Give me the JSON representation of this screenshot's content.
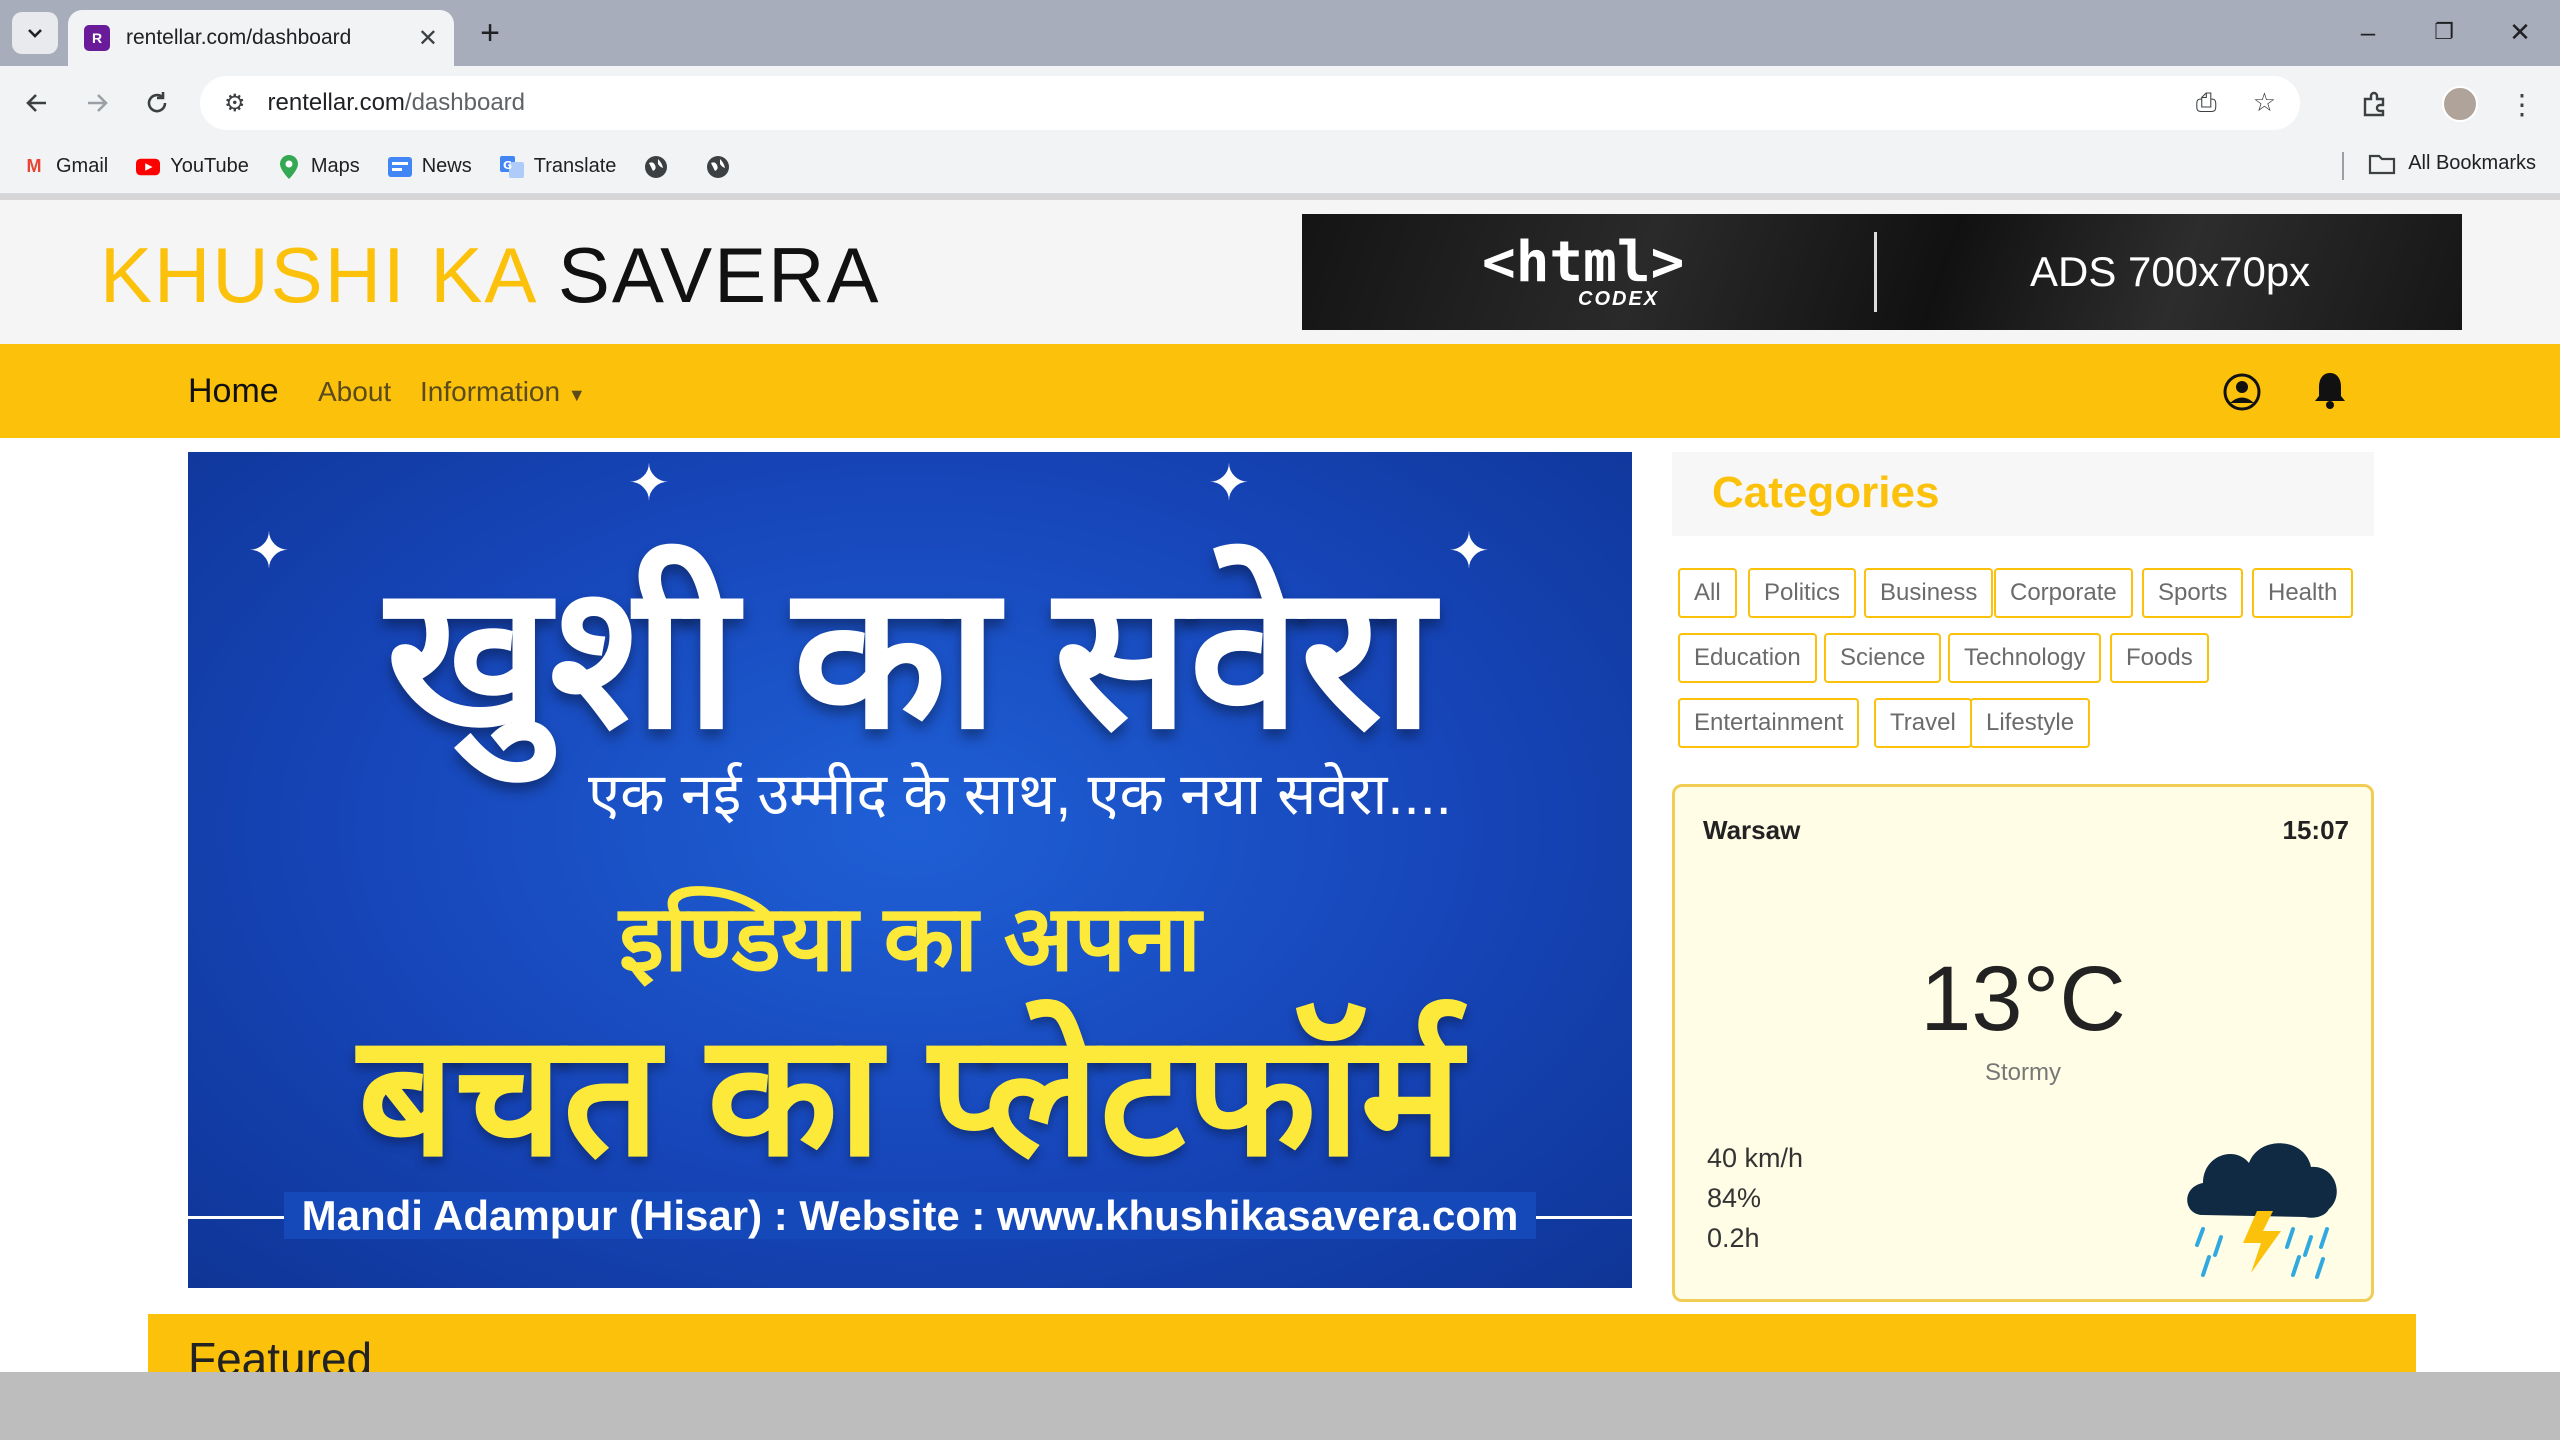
{
  "browser": {
    "tab_title": "rentellar.com/dashboard",
    "url_host": "rentellar.com",
    "url_path": "/dashboard",
    "bookmarks": [
      {
        "label": "Gmail",
        "icon": "gmail-icon"
      },
      {
        "label": "YouTube",
        "icon": "youtube-icon"
      },
      {
        "label": "Maps",
        "icon": "maps-icon"
      },
      {
        "label": "News",
        "icon": "news-icon"
      },
      {
        "label": "Translate",
        "icon": "translate-icon"
      }
    ],
    "all_bookmarks_label": "All Bookmarks"
  },
  "site": {
    "logo_part1": "KHUSHI KA",
    "logo_part2": "SAVERA",
    "ad_html": "<html>",
    "ad_codex": "CODEX",
    "ad_text": "ADS 700x70px"
  },
  "nav": {
    "home": "Home",
    "about": "About",
    "information": "Information"
  },
  "hero": {
    "title": "खुशी का सवेरा",
    "subtitle": "एक नई उम्मीद के साथ, एक नया सवेरा....",
    "line3": "इण्डिया का अपना",
    "line4": "बचत का प्लेटफॉर्म",
    "footer": "Mandi Adampur (Hisar) : Website : www.khushikasavera.com"
  },
  "categories": {
    "title": "Categories",
    "tags": [
      "All",
      "Politics",
      "Business",
      "Corporate",
      "Sports",
      "Health",
      "Education",
      "Science",
      "Technology",
      "Foods",
      "Entertainment",
      "Travel",
      "Lifestyle"
    ]
  },
  "weather": {
    "city": "Warsaw",
    "time": "15:07",
    "temperature": "13°C",
    "condition": "Stormy",
    "wind": "40 km/h",
    "humidity": "84%",
    "duration": "0.2h",
    "icon": "storm-cloud-icon"
  },
  "featured": {
    "title": "Featured"
  },
  "colors": {
    "accent": "#fcc10a",
    "hero_blue": "#1645b8",
    "hero_yellow": "#fde93a"
  }
}
